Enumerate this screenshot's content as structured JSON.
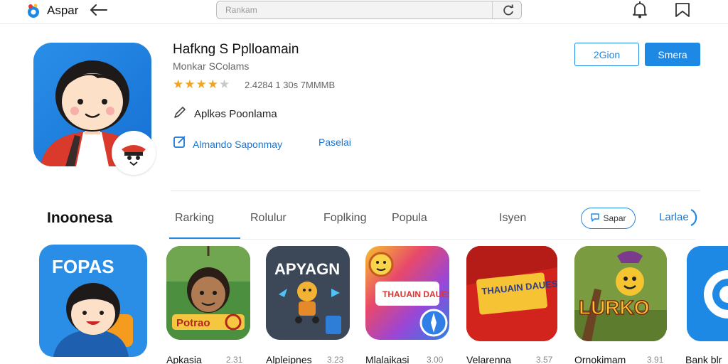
{
  "topbar": {
    "brand_name": "Aspar",
    "search_placeholder": "Rankam"
  },
  "hero": {
    "title": "Hafkng S Pplloamain",
    "developer": "Monkar SColams",
    "rating_stars": 4,
    "rating_max": 5,
    "rating_text": "2.4284  1 30s 7MMMB",
    "category": "Aplkəs Poonlama",
    "link_primary": "Almando Saponmay",
    "link_secondary": "Paselai",
    "btn_outline": "2Gion",
    "btn_solid": "Smera"
  },
  "section": {
    "title": "Inoonesa",
    "tabs": [
      "Rarking",
      "Rolulur",
      "Foplking",
      "Popula",
      "Isyen"
    ],
    "active_tab": 0,
    "pill_label": "Sapar",
    "more_label": "Larlae"
  },
  "apps": [
    {
      "name": "Apkasia",
      "meta": "2.31",
      "icon_text": "FOPAS"
    },
    {
      "name": "Alpleipnes",
      "meta": "3.23",
      "icon_text": "Potrao"
    },
    {
      "name": "Mlalaikasi",
      "meta": "3.00",
      "icon_text": "APYAGN"
    },
    {
      "name": "Velarenna",
      "meta": "3.57",
      "icon_text": "THAUAIN DAUES"
    },
    {
      "name": "Ornokimam",
      "meta": "3.91",
      "icon_text": "LURKO"
    },
    {
      "name": "Bank blr",
      "meta": "",
      "icon_text": ""
    }
  ],
  "colors": {
    "accent": "#1e88e5",
    "star": "#f0a623"
  }
}
